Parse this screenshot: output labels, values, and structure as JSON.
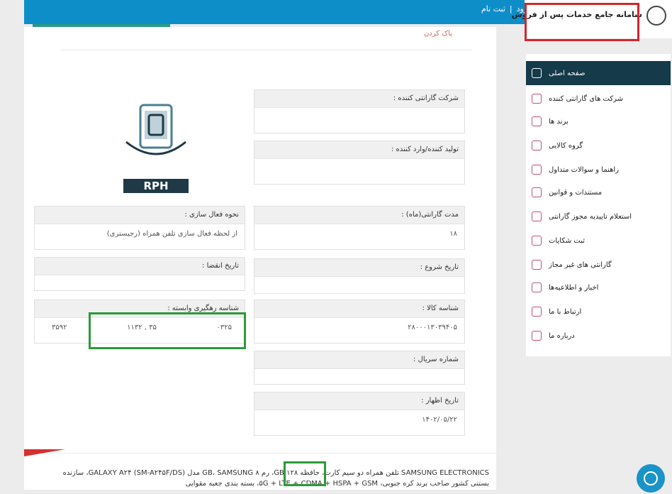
{
  "header": {
    "login_label": "ورود",
    "separator": "|",
    "register_label": "ثبت نام",
    "brand_title": "سامانه جامع خدمات پس از فروش"
  },
  "breadcrumb": "پاک کردن",
  "fields": {
    "company": {
      "label": "شرکت گارانتی کننده :",
      "value": ""
    },
    "producer": {
      "label": "تولید کننده/وارد کننده :",
      "value": ""
    },
    "duration": {
      "label": "مدت گارانتی(ماه) :",
      "value": "۱۸"
    },
    "start": {
      "label": "تاریخ شروع :",
      "value": ""
    },
    "code": {
      "label": "شناسه کالا :",
      "value": "۲۸۰۰۰۱۳۰۳۹۴۰۵"
    },
    "serial": {
      "label": "شماره سریال :",
      "value": ""
    },
    "show": {
      "label": "تاریخ اظهار :",
      "value": "۱۴۰۲/۰۵/۲۲"
    },
    "activation": {
      "label": "نحوه فعال سازی :",
      "value": "از لحظه فعال سازی تلفن همراه (رجیستری)"
    },
    "expire": {
      "label": "تاریخ انقضا :",
      "value": ""
    },
    "tracking": {
      "label": "شناسه رهگیری وابسته :",
      "values": [
        "۰۳۲۵",
        "۱۱۳۲ , ۳۵",
        "۳۵۹۲"
      ]
    }
  },
  "logo_text": "RPH",
  "description": {
    "line1": "SAMSUNG ELECTRONICS تلفن همراه دو سیم کارت، حافظه ۱۲۸ GB، رم ۸ GB، SAMSUNG مدل GALAXY A۲۴ (SM-A۲۴۵F/DS)، سازنده",
    "line2": "بستنی کشور صاحب برند کره جنوبی، ۵G + LTE + CDMA + HSPA + GSM، بسته بندی جعبه مقوایی"
  },
  "sidebar": {
    "items": [
      {
        "label": "صفحه اصلی",
        "icon": "home-icon"
      },
      {
        "label": "شرکت های گارانتی کننده",
        "icon": "company-icon"
      },
      {
        "label": "برند ها",
        "icon": "tag-icon"
      },
      {
        "label": "گروه کالایی",
        "icon": "box-icon"
      },
      {
        "label": "راهنما و سوالات متداول",
        "icon": "help-icon"
      },
      {
        "label": "مستندات و قوانین",
        "icon": "document-icon"
      },
      {
        "label": "استعلام تاییدیه مجوز گارانتی",
        "icon": "check-icon"
      },
      {
        "label": "ثبت شکایات",
        "icon": "complaint-icon"
      },
      {
        "label": "گارانتی های غیر مجاز",
        "icon": "warning-icon"
      },
      {
        "label": "اخبار و اطلاعیه‌ها",
        "icon": "globe-icon"
      },
      {
        "label": "ارتباط با ما",
        "icon": "phone-icon"
      },
      {
        "label": "درباره ما",
        "icon": "info-icon"
      }
    ]
  },
  "colors": {
    "topbar": "#0e8ec9",
    "sidebar_active": "#153a4a",
    "highlight_red": "#d4262b",
    "highlight_green": "#2c9a3a"
  }
}
